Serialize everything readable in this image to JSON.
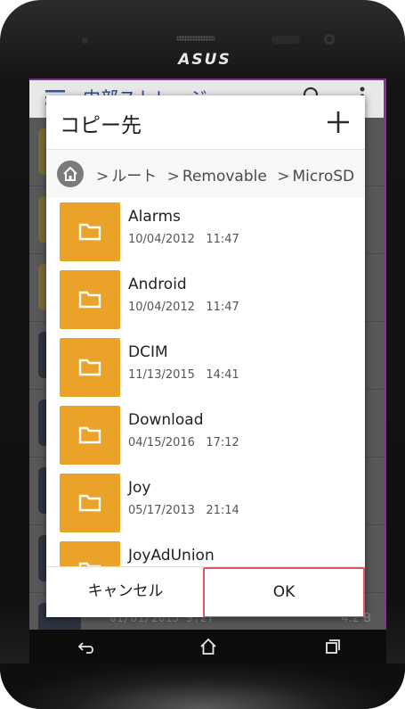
{
  "device": {
    "brand": "ASUS"
  },
  "background_screen": {
    "title": "内部ストレージ",
    "bottom_date": "01/01/2015 9:27",
    "bottom_size": "4.2 B"
  },
  "dialog": {
    "title": "コピー先",
    "add_label": "+",
    "breadcrumb": [
      "ルート",
      "Removable",
      "MicroSD"
    ],
    "files": [
      {
        "name": "Alarms",
        "date": "10/04/2012   11:47"
      },
      {
        "name": "Android",
        "date": "10/04/2012   11:47"
      },
      {
        "name": "DCIM",
        "date": "11/13/2015   14:41"
      },
      {
        "name": "Download",
        "date": "04/15/2016   17:12"
      },
      {
        "name": "Joy",
        "date": "05/17/2013   21:14"
      },
      {
        "name": "JoyAdUnion",
        "date": ""
      }
    ],
    "cancel_label": "キャンセル",
    "ok_label": "OK"
  },
  "colors": {
    "folder": "#eaa229",
    "highlight_border": "#e0556b",
    "screen_edge": "#8a2f9c"
  },
  "icons": {
    "add": "plus-icon",
    "home": "home-icon",
    "folder": "folder-icon",
    "back": "back-icon",
    "nav_home": "home-outline-icon",
    "recents": "recents-icon"
  }
}
